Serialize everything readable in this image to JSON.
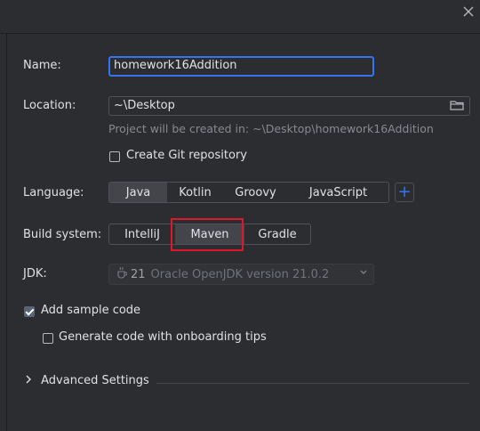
{
  "form": {
    "name_label": "Name:",
    "name_value": "homework16Addition",
    "location_label": "Location:",
    "location_value": "~\\Desktop",
    "location_hint": "Project will be created in: ~\\Desktop\\homework16Addition",
    "git_label": "Create Git repository",
    "git_checked": false,
    "language_label": "Language:",
    "languages": [
      "Java",
      "Kotlin",
      "Groovy",
      "JavaScript"
    ],
    "language_selected": "Java",
    "add_language_glyph": "+",
    "build_label": "Build system:",
    "build_systems": [
      "IntelliJ",
      "Maven",
      "Gradle"
    ],
    "build_selected": "Maven",
    "jdk_label": "JDK:",
    "jdk_version": "21",
    "jdk_name": "Oracle OpenJDK version 21.0.2",
    "sample_code_label": "Add sample code",
    "sample_code_checked": true,
    "onboarding_label": "Generate code with onboarding tips",
    "onboarding_checked": false,
    "advanced_label": "Advanced Settings"
  },
  "icons": {
    "close": "close-icon",
    "folder": "folder-icon",
    "jdk": "java-cup-icon",
    "chevron": "chevron-right-icon",
    "dropdown": "chevron-down-icon"
  },
  "colors": {
    "background": "#2b2d30",
    "accent": "#3574f0",
    "highlight_box": "#e0162b",
    "selected_segment": "#43454a"
  }
}
